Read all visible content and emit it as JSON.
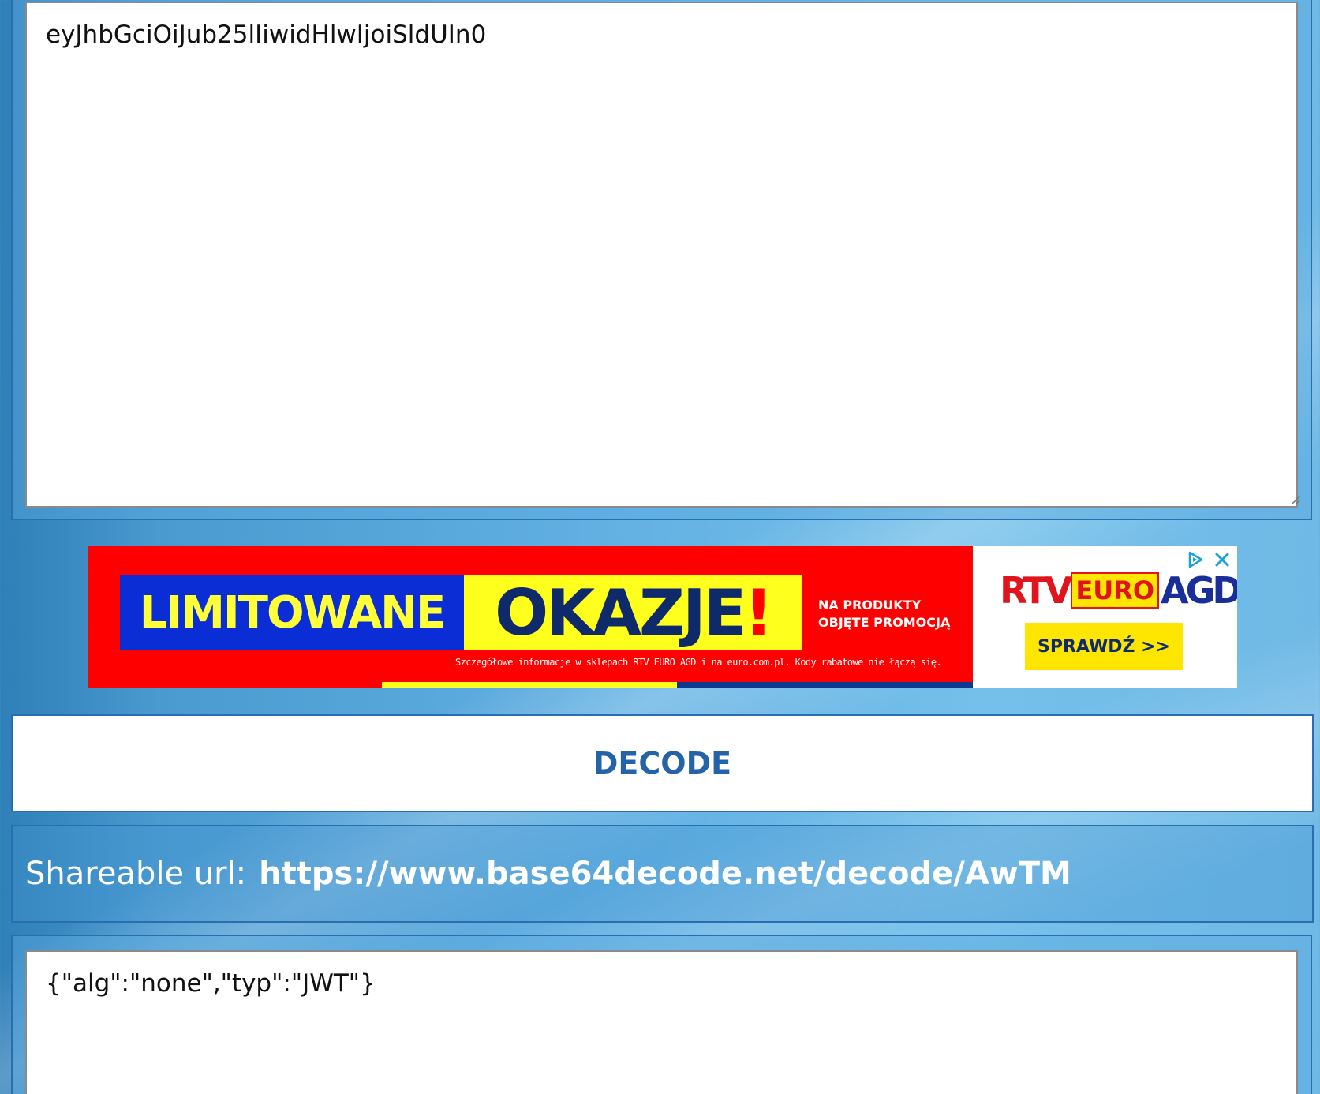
{
  "input": {
    "value": "eyJhbGciOiJub25lIiwidHlwIjoiSldUIn0"
  },
  "ad": {
    "headline_left": "LIMITOWANE",
    "headline_mid": "OKAZJE",
    "headline_exclaim": "!",
    "promo_line1": "NA PRODUKTY",
    "promo_line2": "OBJĘTE PROMOCJĄ",
    "fineprint": "Szczegółowe informacje w sklepach RTV EURO AGD i na euro.com.pl. Kody rabatowe nie łączą się.",
    "logo_rtv": "RTV",
    "logo_euro": "EURO",
    "logo_agd": "AGD",
    "cta_label": "SPRAWDŹ >>",
    "colors": {
      "background": "#ff0000",
      "yellow": "#ffff1e",
      "blue": "#0b2dd6",
      "navy": "#0f2a6b"
    },
    "icons": [
      "ad-choices-icon",
      "close-icon"
    ]
  },
  "decode_button": {
    "label": "DECODE"
  },
  "share": {
    "label": "Shareable url:",
    "url": "https://www.base64decode.net/decode/AwTM"
  },
  "output": {
    "value": "{\"alg\":\"none\",\"typ\":\"JWT\"}"
  },
  "theme": {
    "accent": "#2563a8",
    "border": "#2a6db0"
  }
}
